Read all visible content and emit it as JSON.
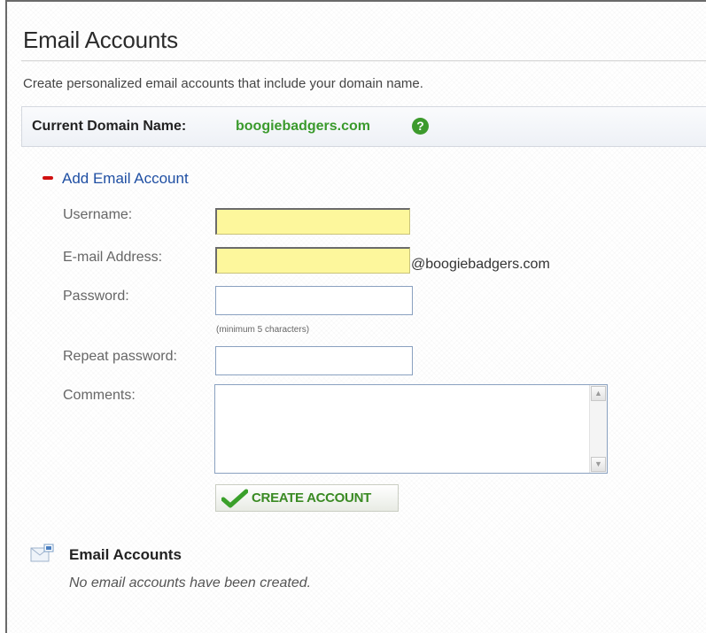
{
  "page": {
    "title": "Email Accounts",
    "intro": "Create personalized email accounts that include your domain name."
  },
  "domain": {
    "label": "Current Domain Name:",
    "value": "boogiebadgers.com",
    "help_icon": "?"
  },
  "add_section": {
    "toggle_icon": "minus-icon",
    "link_label": "Add Email Account"
  },
  "form": {
    "username_label": "Username:",
    "username_value": "",
    "email_label": "E-mail Address:",
    "email_value": "",
    "email_suffix": "@boogiebadgers.com",
    "password_label": "Password:",
    "password_value": "",
    "password_hint": "(minimum 5 characters)",
    "repeat_label": "Repeat password:",
    "repeat_value": "",
    "comments_label": "Comments:",
    "comments_value": "",
    "submit_label": "CREATE ACCOUNT"
  },
  "accounts": {
    "title": "Email Accounts",
    "empty_message": "No email accounts have been created."
  },
  "colors": {
    "required_field": "#fdf79c",
    "domain_green": "#3a9a2c",
    "link_blue": "#1f4fa3",
    "toggle_red": "#d01010"
  }
}
